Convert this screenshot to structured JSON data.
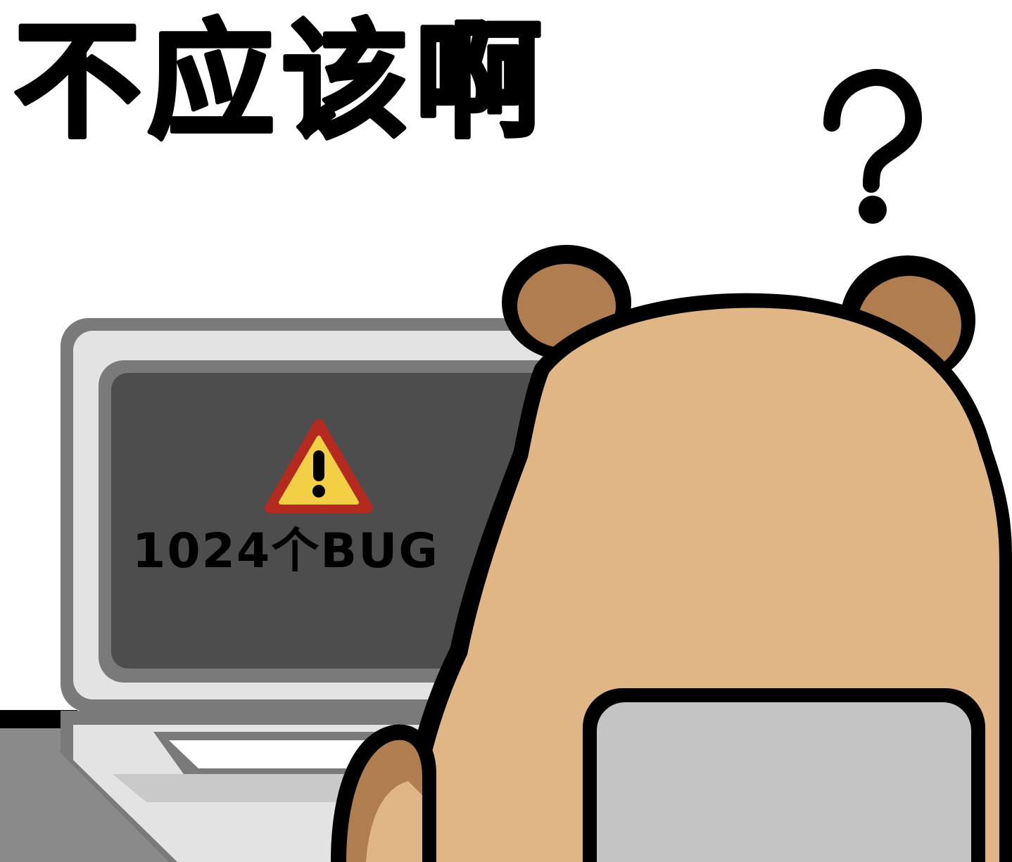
{
  "caption": {
    "text": "不应该啊"
  },
  "laptop": {
    "screen_message": "1024个BUG",
    "warning_icon": "warning-triangle-icon"
  },
  "bear": {
    "thought_symbol": "?"
  },
  "colors": {
    "background": "#ffffff",
    "outline": "#000000",
    "bear_fur": "#e0b686",
    "bear_ear_inner": "#b07d50",
    "bear_back_patch": "#c4c4c4",
    "laptop_body": "#e3e3e3",
    "laptop_frame": "#7a7a7a",
    "screen": "#4d4d4d",
    "desk": "#8a8a8a",
    "warning_fill": "#f2cf45",
    "warning_border": "#b52a1e"
  }
}
